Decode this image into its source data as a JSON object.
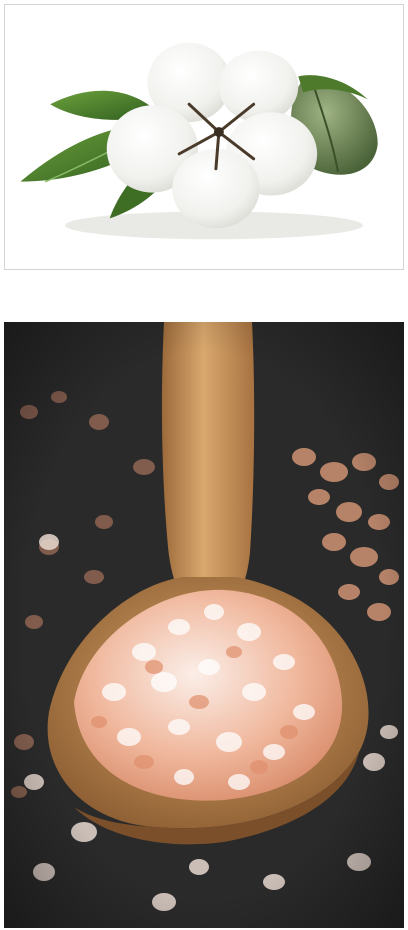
{
  "images": [
    {
      "subject": "cotton-boll",
      "colors": {
        "background": "#ffffff",
        "fluff": "#f4f4f2",
        "leaf": "#4f8a2e",
        "pod": "#6f8756"
      }
    },
    {
      "subject": "salt-spoon",
      "colors": {
        "background": "#262626",
        "wood": "#c9965d",
        "salt_pink": "#e9a98c",
        "salt_white": "#f6e8e0"
      }
    }
  ]
}
